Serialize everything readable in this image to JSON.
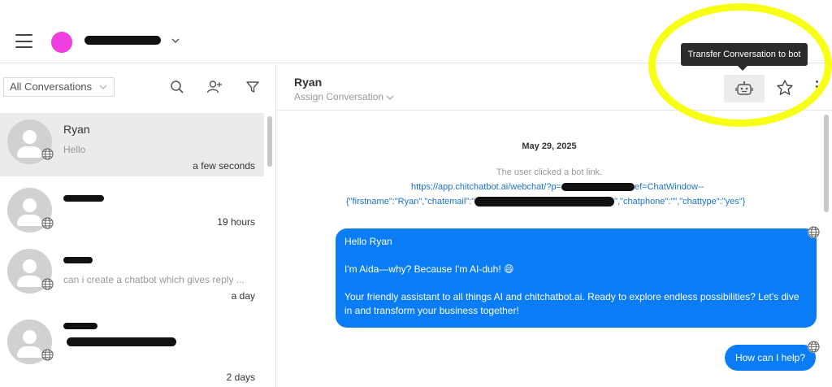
{
  "header": {
    "account_name": "",
    "tooltip": "Transfer Conversation to bot"
  },
  "colors": {
    "accent_blue": "#0a7cf5",
    "avatar_pink": "#f03fe0",
    "highlight_yellow": "#f7ff14"
  },
  "sidebar": {
    "filter_value": "All Conversations",
    "conversations": [
      {
        "name": "Ryan",
        "preview": "Hello",
        "time": "a few seconds"
      },
      {
        "name": "",
        "preview": "",
        "time": "19 hours"
      },
      {
        "name": "",
        "preview": "can i create a chatbot which gives reply ...",
        "time": "a day"
      },
      {
        "name": "",
        "preview": "",
        "time": "2 days"
      }
    ]
  },
  "chat": {
    "title": "Ryan",
    "assign_label": "Assign Conversation",
    "date": "May 29, 2025",
    "system_message": "The user clicked a bot link.",
    "link_line1": "https://app.chitchatbot.ai/webchat/?p=",
    "link_line1_suffix": "ef=ChatWindow--",
    "link_line2_a": "{\"firstname\":\"Ryan\",\"chatemail\":\"",
    "link_line2_b": "\",\"chatphone\":\"\",\"chattype\":\"yes\"}",
    "bot_message": {
      "line1": "Hello Ryan",
      "line2": "I'm Aida—why? Because I'm AI-duh! 😄",
      "line3": "Your friendly assistant to all things AI and chitchatbot.ai. Ready to explore endless possibilities? Let's dive in and transform your business together!"
    },
    "bot_message2": "How can I help?"
  }
}
